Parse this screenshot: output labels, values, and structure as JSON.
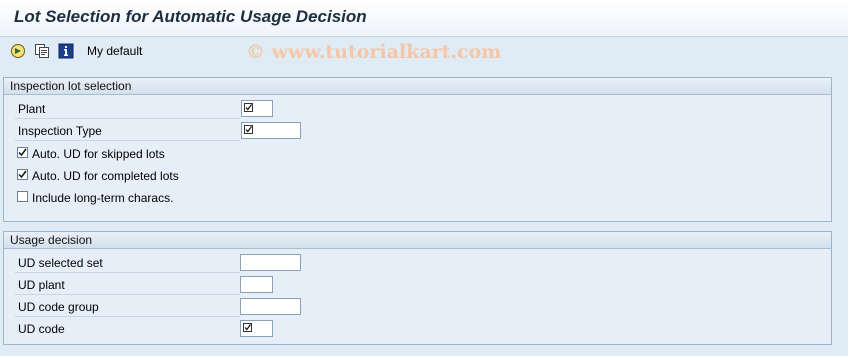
{
  "window": {
    "title": "Lot Selection for Automatic Usage Decision"
  },
  "toolbar": {
    "icons": [
      "execute-icon",
      "save-variant-icon",
      "info-icon"
    ],
    "variant_label": "My default"
  },
  "watermark": "© www.tutorialkart.com",
  "inspection_lot_selection": {
    "title": "Inspection lot selection",
    "plant_label": "Plant",
    "inspection_type_label": "Inspection Type",
    "checkboxes": [
      {
        "label": "Auto. UD for skipped lots",
        "checked": true
      },
      {
        "label": "Auto. UD for completed lots",
        "checked": true
      },
      {
        "label": "Include long-term characs.",
        "checked": false
      }
    ]
  },
  "usage_decision": {
    "title": "Usage decision",
    "ud_selected_set_label": "UD selected set",
    "ud_plant_label": "UD plant",
    "ud_code_group_label": "UD code group",
    "ud_code_label": "UD code"
  }
}
